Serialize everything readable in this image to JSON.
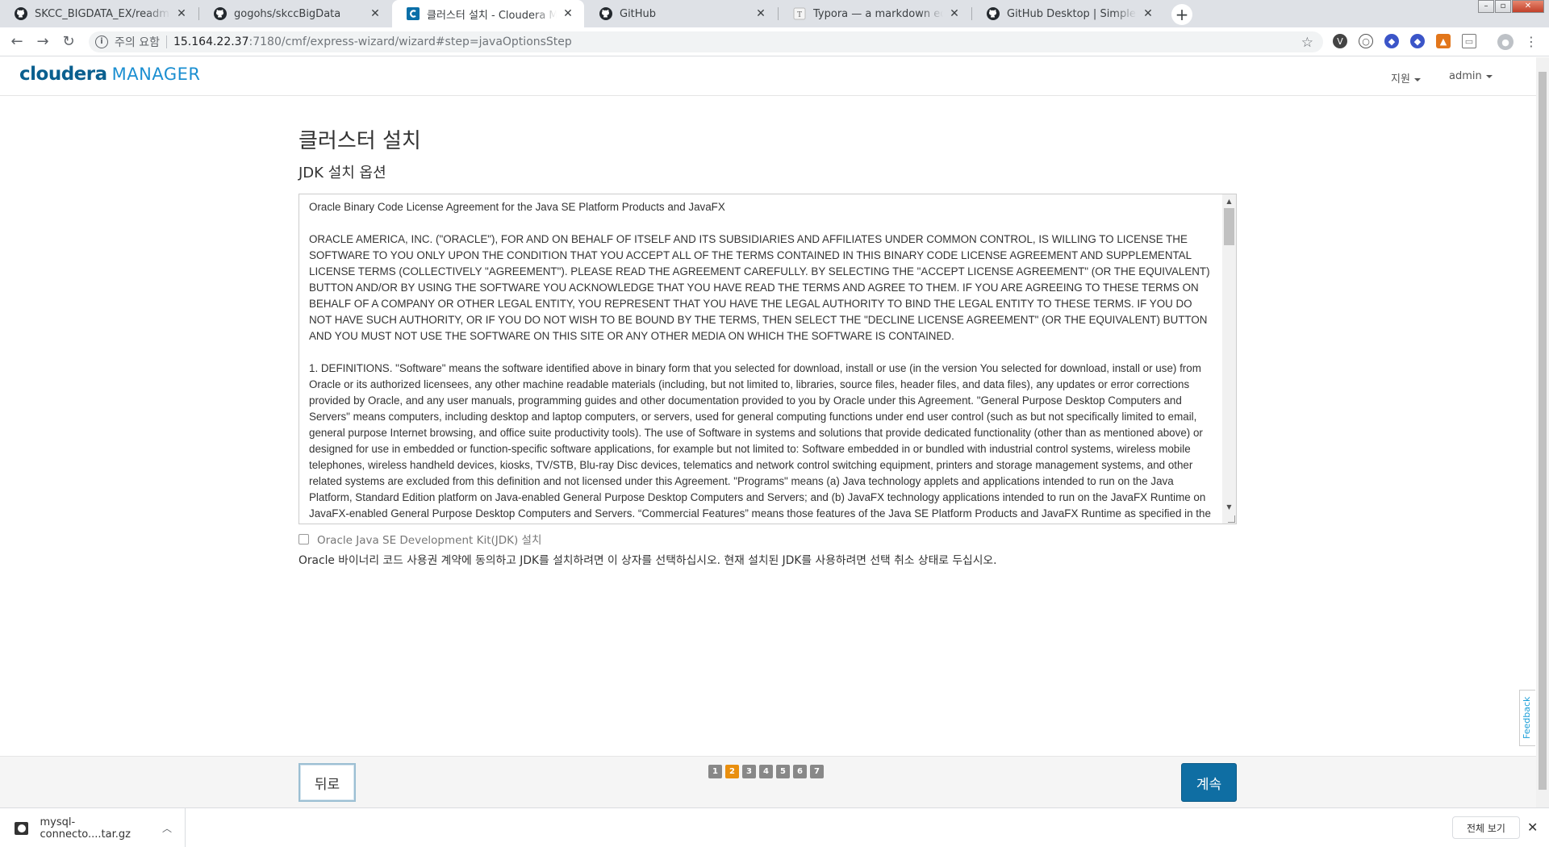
{
  "browser": {
    "tabs": [
      {
        "title": "SKCC_BIGDATA_EX/readme.md at",
        "icon": "github-icon"
      },
      {
        "title": "gogohs/skccBigData",
        "icon": "github-icon"
      },
      {
        "title": "클러스터 설치 - Cloudera Mana",
        "icon": "cloudera-icon"
      },
      {
        "title": "GitHub",
        "icon": "github-icon"
      },
      {
        "title": "Typora — a markdown editor, m",
        "icon": "typora-icon"
      },
      {
        "title": "GitHub Desktop | Simple collab",
        "icon": "github-icon"
      }
    ],
    "security_label": "주의 요함",
    "url_host": "15.164.22.37",
    "url_path": ":7180/cmf/express-wizard/wizard#step=javaOptionsStep"
  },
  "header": {
    "logo_primary": "cloudera",
    "logo_secondary": "MANAGER",
    "support_label": "지원",
    "user_label": "admin"
  },
  "main": {
    "title": "클러스터 설치",
    "subtitle": "JDK 설치 옵션",
    "license_paragraphs": [
      "Oracle Binary Code License Agreement for the Java SE Platform Products and JavaFX",
      "ORACLE AMERICA, INC. (\"ORACLE\"), FOR AND ON BEHALF OF ITSELF AND ITS SUBSIDIARIES AND AFFILIATES UNDER COMMON CONTROL, IS WILLING TO LICENSE THE SOFTWARE TO YOU ONLY UPON THE CONDITION THAT YOU ACCEPT ALL OF THE TERMS CONTAINED IN THIS BINARY CODE LICENSE AGREEMENT AND SUPPLEMENTAL LICENSE TERMS (COLLECTIVELY \"AGREEMENT\"). PLEASE READ THE AGREEMENT CAREFULLY. BY SELECTING THE \"ACCEPT LICENSE AGREEMENT\" (OR THE EQUIVALENT) BUTTON AND/OR BY USING THE SOFTWARE YOU ACKNOWLEDGE THAT YOU HAVE READ THE TERMS AND AGREE TO THEM. IF YOU ARE AGREEING TO THESE TERMS ON BEHALF OF A COMPANY OR OTHER LEGAL ENTITY, YOU REPRESENT THAT YOU HAVE THE LEGAL AUTHORITY TO BIND THE LEGAL ENTITY TO THESE TERMS. IF YOU DO NOT HAVE SUCH AUTHORITY, OR IF YOU DO NOT WISH TO BE BOUND BY THE TERMS, THEN SELECT THE \"DECLINE LICENSE AGREEMENT\" (OR THE EQUIVALENT) BUTTON AND YOU MUST NOT USE THE SOFTWARE ON THIS SITE OR ANY OTHER MEDIA ON WHICH THE SOFTWARE IS CONTAINED.",
      "1. DEFINITIONS. \"Software\" means the software identified above in binary form that you selected for download, install or use (in the version You selected for download, install or use) from Oracle or its authorized licensees, any other machine readable materials (including, but not limited to, libraries, source files, header files, and data files), any updates or error corrections provided by Oracle, and any user manuals, programming guides and other documentation provided to you by Oracle under this Agreement. \"General Purpose Desktop Computers and Servers\" means computers, including desktop and laptop computers, or servers, used for general computing functions under end user control (such as but not specifically limited to email, general purpose Internet browsing, and office suite productivity tools). The use of Software in systems and solutions that provide dedicated functionality (other than as mentioned above) or designed for use in embedded or function-specific software applications, for example but not limited to: Software embedded in or bundled with industrial control systems, wireless mobile telephones, wireless handheld devices, kiosks, TV/STB, Blu-ray Disc devices, telematics and network control switching equipment, printers and storage management systems, and other related systems are excluded from this definition and not licensed under this Agreement. \"Programs\" means (a) Java technology applets and applications intended to run on the Java Platform, Standard Edition platform on Java-enabled General Purpose Desktop Computers and Servers; and (b) JavaFX technology applications intended to run on the JavaFX Runtime on JavaFX-enabled General Purpose Desktop Computers and Servers. “Commercial Features” means those features of the Java SE Platform Products and JavaFX Runtime as specified in the Java SE documentation."
    ],
    "jdk_checkbox_label": "Oracle Java SE Development Kit(JDK) 설치",
    "jdk_checked": false,
    "jdk_help": "Oracle 바이너리 코드 사용권 계약에 동의하고 JDK를 설치하려면 이 상자를 선택하십시오. 현재 설치된 JDK를 사용하려면 선택 취소 상태로 두십시오."
  },
  "feedback_label": "Feedback",
  "footer": {
    "back_label": "뒤로",
    "next_label": "계속",
    "steps": [
      "1",
      "2",
      "3",
      "4",
      "5",
      "6",
      "7"
    ],
    "current_step": 2
  },
  "downloads": {
    "file_name": "mysql-connecto....tar.gz",
    "show_all_label": "전체 보기"
  },
  "colors": {
    "accent": "#0f6ea3",
    "step_current": "#e98f0f",
    "logo_dark": "#0a5f8f",
    "logo_light": "#1b8fd1"
  }
}
